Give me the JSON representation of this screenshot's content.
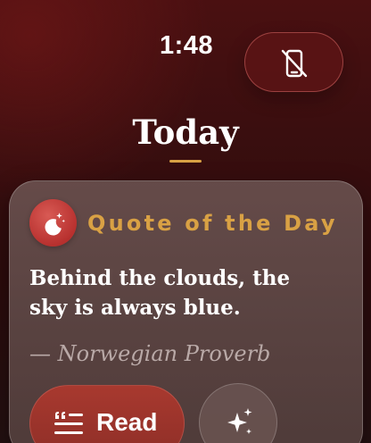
{
  "status": {
    "time": "1:48"
  },
  "header": {
    "title": "Today",
    "device_button_icon": "phone-off-icon"
  },
  "quote_card": {
    "icon": "moon-stars-icon",
    "heading": "Quote of the Day",
    "quote": "Behind the clouds, the sky is always blue.",
    "author": "— Norwegian Proverb",
    "read_button": {
      "icon": "quote-lines-icon",
      "label": "Read"
    },
    "sparkle_button": {
      "icon": "sparkles-icon"
    }
  },
  "colors": {
    "accent_gold": "#d9a144",
    "primary_red": "#a8392f",
    "background_dark": "#2c0b0c"
  }
}
